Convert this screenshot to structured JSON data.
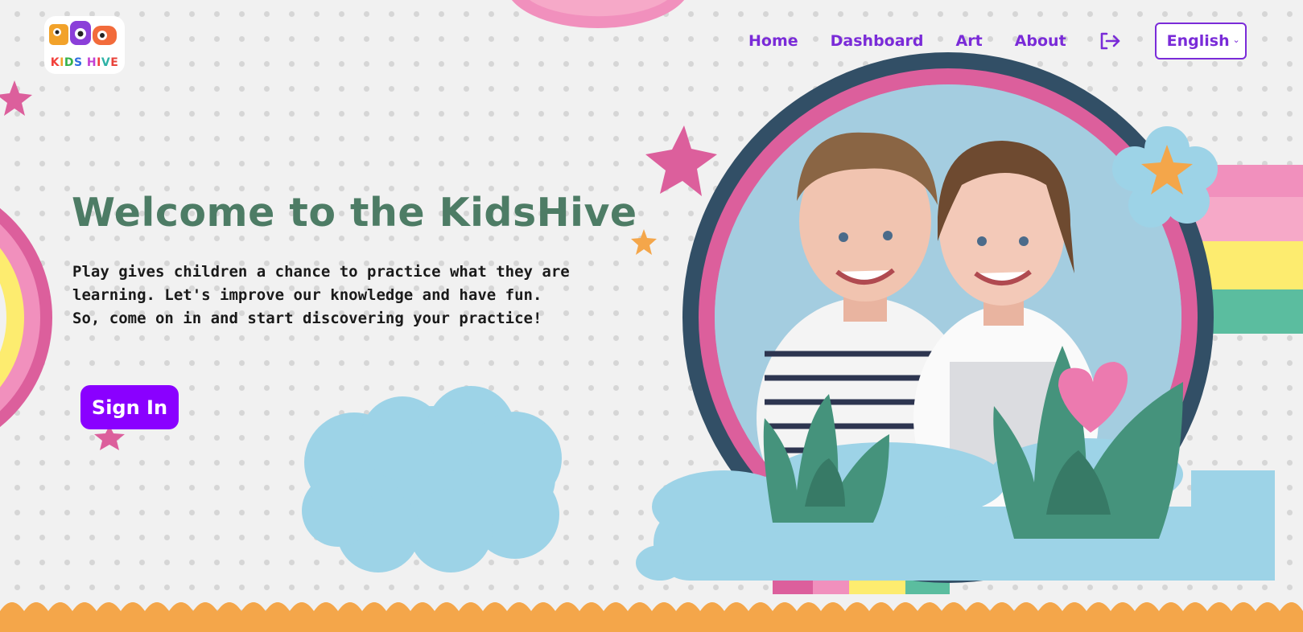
{
  "brand": {
    "logo_text": "KIDS HIVE",
    "logo_letter_colors": [
      "#f2403b",
      "#f2a22a",
      "#35b24a",
      "#2f6ee0",
      "#c23fd3",
      "#f2403b",
      "#2fb3a7",
      "#e8433b"
    ]
  },
  "nav": {
    "items": [
      {
        "label": "Home"
      },
      {
        "label": "Dashboard"
      },
      {
        "label": "Art"
      },
      {
        "label": "About"
      }
    ],
    "logout_icon": "logout-icon",
    "language": {
      "selected": "English",
      "caret_icon": "chevron-down-icon"
    }
  },
  "hero": {
    "title": "Welcome to the KidsHive",
    "description_lines": [
      "Play gives children a chance to practice what they are",
      "learning. Let's improve our knowledge and have fun.",
      "So, come on in and start discovering your practice!"
    ],
    "signin_label": "Sign In"
  },
  "colors": {
    "accent": "#7a2bd8",
    "button": "#8a00ff",
    "title": "#4d7c65",
    "pink": "#dc5f9c",
    "light_pink": "#f190bd",
    "yellow": "#fdec6f",
    "teal": "#5bbd9f",
    "sky": "#9dd3e7",
    "orange": "#f4a64a",
    "green": "#45937c",
    "navy": "#324f66",
    "background": "#f1f1f1"
  }
}
